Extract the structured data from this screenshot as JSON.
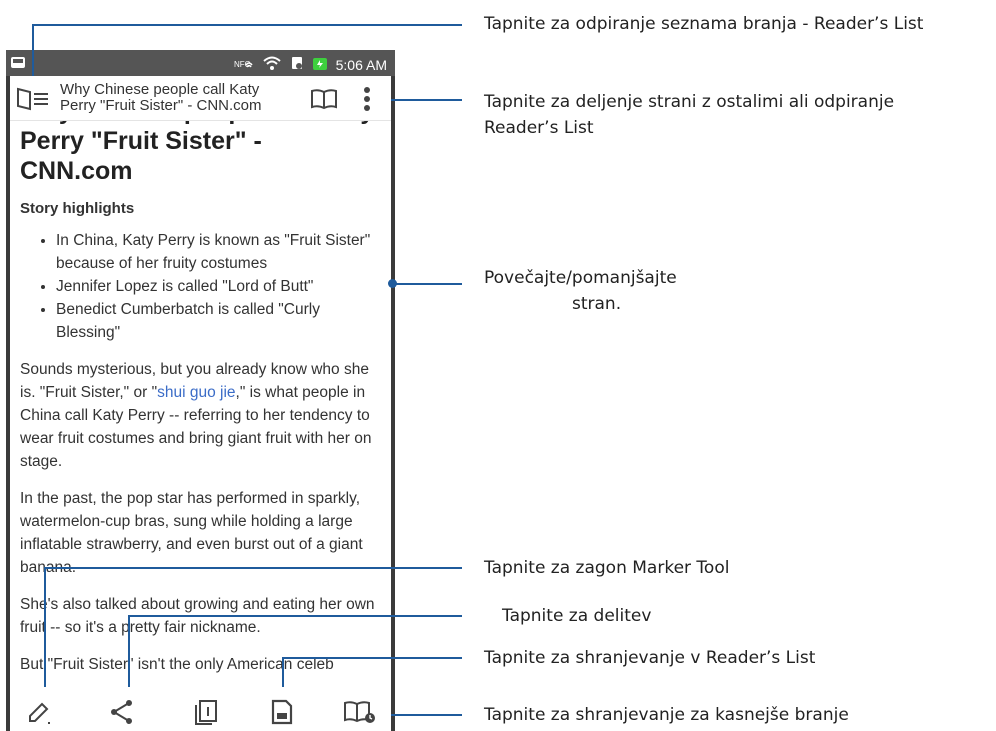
{
  "status_bar": {
    "time": "5:06 AM",
    "nfc_label": "NFC"
  },
  "reader_top": {
    "tab_title": "Why Chinese people call Katy Perry \"Fruit Sister\" - CNN.com"
  },
  "article": {
    "headline_partial": "Why Chinese people call Katy",
    "headline": "Perry \"Fruit Sister\" - CNN.com",
    "highlights_title": "Story highlights",
    "highlights": [
      "In China, Katy Perry is known as \"Fruit Sister\" because of her fruity costumes",
      "Jennifer Lopez is called \"Lord of Butt\"",
      "Benedict Cumberbatch is called \"Curly Blessing\""
    ],
    "p1_before": "Sounds mysterious, but you already know who she is. \"Fruit Sister,\" or \"",
    "p1_link": "shui guo jie",
    "p1_after": ",\" is what people in China call Katy Perry -- referring to her tendency to wear fruit costumes and bring giant fruit with her on stage.",
    "p2": "In the past, the pop star has performed in sparkly, watermelon-cup bras, sung while holding a large inflatable strawberry, and even burst out of a giant banana.",
    "p3": "She's also talked about growing and eating her own fruit -- so it's a pretty fair nickname.",
    "p4": "But \"Fruit Sister\" isn't the only American celeb"
  },
  "callouts": {
    "reading_list": "Tapnite za odpiranje seznama branja - Reader’s List",
    "share_menu_line1": "Tapnite za deljenje strani z ostalimi ali odpiranje",
    "share_menu_line2": "Reader’s List",
    "zoom_line1": "Povečajte/pomanjšajte",
    "zoom_line2": "stran.",
    "marker": "Tapnite za zagon Marker Tool",
    "share": "Tapnite za delitev",
    "save_list": "Tapnite za shranjevanje v Reader’s List",
    "save_later": "Tapnite za shranjevanje za kasnejše branje"
  },
  "colors": {
    "callout_line": "#1f5b9c",
    "status_bar": "#555555",
    "link": "#3b6cc7"
  }
}
